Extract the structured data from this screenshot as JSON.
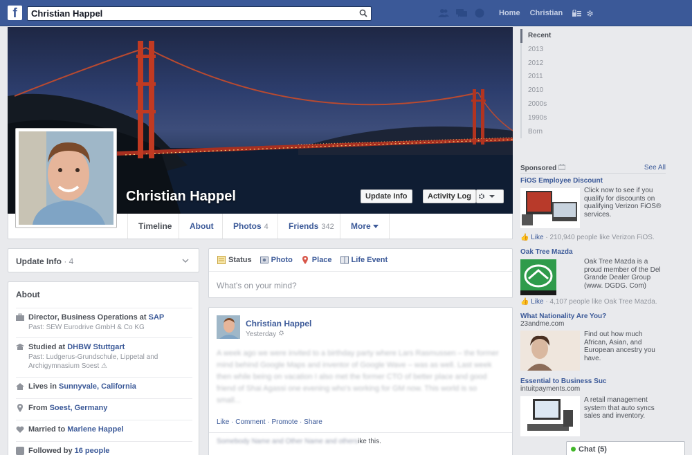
{
  "topbar": {
    "search_value": "Christian Happel",
    "nav": [
      "Home",
      "Christian"
    ],
    "brand_color": "#3b5998"
  },
  "profile": {
    "name": "Christian Happel",
    "update_info_btn": "Update Info",
    "activity_log_btn": "Activity Log"
  },
  "tabs": [
    {
      "label": "Timeline",
      "count": ""
    },
    {
      "label": "About",
      "count": ""
    },
    {
      "label": "Photos",
      "count": "4"
    },
    {
      "label": "Friends",
      "count": "342"
    },
    {
      "label": "More",
      "count": ""
    }
  ],
  "left": {
    "update_info_label": "Update Info",
    "update_info_count": "· 4",
    "about_heading": "About",
    "about_items": [
      {
        "icon": "briefcase-icon",
        "prefix": "Director, Business Operations at ",
        "link": "SAP",
        "sub": "Past: SEW Eurodrive GmbH & Co KG"
      },
      {
        "icon": "graduation-icon",
        "prefix": "Studied at ",
        "link": "DHBW Stuttgart",
        "sub": "Past: Ludgerus-Grundschule, Lippetal and Archigymnasium Soest ⚠"
      },
      {
        "icon": "house-icon",
        "prefix": "Lives in ",
        "link": "Sunnyvale, California",
        "sub": ""
      },
      {
        "icon": "location-pin-icon",
        "prefix": "From ",
        "link": "Soest, Germany",
        "sub": ""
      },
      {
        "icon": "heart-icon",
        "prefix": "Married to ",
        "link": "Marlene Happel",
        "sub": ""
      },
      {
        "icon": "rss-icon",
        "prefix": "Followed by ",
        "link": "16 people",
        "sub": ""
      }
    ]
  },
  "composer": {
    "tabs": [
      "Status",
      "Photo",
      "Place",
      "Life Event"
    ],
    "placeholder": "What's on your mind?"
  },
  "post": {
    "author": "Christian Happel",
    "time": "Yesterday",
    "body": "A week ago we were invited to a birthday party where Lars Rasmussen – the former mind behind Google Maps and inventor of Google Wave – was as well. Last week then while being on vacation I also met the former CTO of better place and good friend of Shai Agassi one evening who's working for GM now. This world is so small...",
    "actions": "Like · Comment · Promote · Share",
    "likes_blurred": "Somebody Name and Other Name and others",
    "likes_suffix": "ike this."
  },
  "years": [
    "Recent",
    "2013",
    "2012",
    "2011",
    "2010",
    "2000s",
    "1990s",
    "Born"
  ],
  "sponsored": {
    "heading": "Sponsored",
    "see_all": "See All",
    "ads": [
      {
        "title": "FiOS Employee Discount",
        "domain": "",
        "desc": "Click now to see if you qualify for discounts on qualifying Verizon FiOS® services.",
        "like": "Like",
        "like_text": " · 210,940 people like Verizon FiOS."
      },
      {
        "title": "Oak Tree Mazda",
        "domain": "",
        "desc": "Oak Tree Mazda is a proud member of the Del Grande Dealer Group (www. DGDG. Com)",
        "like": "Like",
        "like_text": " · 4,107 people like Oak Tree Mazda."
      },
      {
        "title": "What Nationality Are You?",
        "domain": "23andme.com",
        "desc": "Find out how much African, Asian, and European ancestry you have.",
        "like": "",
        "like_text": ""
      },
      {
        "title": "Essential to Business Suc",
        "domain": "intuitpayments.com",
        "desc": "A retail management system that auto syncs sales and inventory.",
        "like": "",
        "like_text": ""
      }
    ]
  },
  "chat": {
    "label": "Chat (5)"
  }
}
